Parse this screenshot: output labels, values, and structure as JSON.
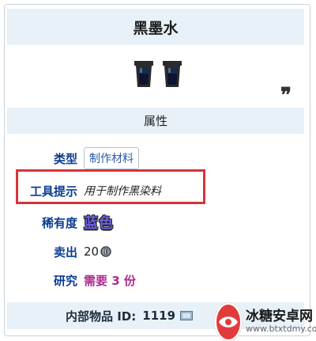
{
  "item": {
    "name": "黑墨水"
  },
  "attributes": {
    "section_title": "属性",
    "type_label": "类型",
    "type_value": "制作材料",
    "tooltip_label": "工具提示",
    "tooltip_value": "用于制作黑染料",
    "rarity_label": "稀有度",
    "rarity_value": "蓝色",
    "sell_label": "卖出",
    "sell_value": "20",
    "research_label": "研究",
    "research_value": "需要 3 份"
  },
  "footer": {
    "internal_id_label": "内部物品 ID:",
    "internal_id_value": "1119"
  },
  "watermark": {
    "title": "冰糖安卓网",
    "url": "www.btxtdmy.com"
  },
  "colors": {
    "header_bg": "#e8f1f8",
    "highlight_border": "#d8333a",
    "rarity_color": "#6b5fe0",
    "research_color": "#b02a8f",
    "link_color": "#2a5aa6"
  },
  "icons": [
    "ink-bottle-icon",
    "ink-bottle-icon",
    "quote-icon",
    "silver-coin-icon",
    "map-icon",
    "watermark-logo-icon"
  ]
}
